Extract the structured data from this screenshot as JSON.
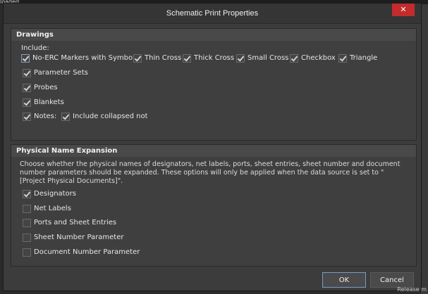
{
  "background": {
    "top_left_text": "loaded",
    "right_bottom_text": "Release m"
  },
  "dialog": {
    "title": "Schematic Print Properties",
    "close_label": "✕"
  },
  "drawings": {
    "header": "Drawings",
    "include_label": "Include:",
    "no_erc": {
      "label": "No-ERC Markers with Symbols:",
      "checked": true
    },
    "symbols": [
      {
        "label": "Thin Cross",
        "checked": true
      },
      {
        "label": "Thick Cross",
        "checked": true
      },
      {
        "label": "Small Cross",
        "checked": true
      },
      {
        "label": "Checkbox",
        "checked": true
      },
      {
        "label": "Triangle",
        "checked": true
      }
    ],
    "parameter_sets": {
      "label": "Parameter Sets",
      "checked": true
    },
    "probes": {
      "label": "Probes",
      "checked": true
    },
    "blankets": {
      "label": "Blankets",
      "checked": true
    },
    "notes": {
      "label": "Notes:",
      "checked": true
    },
    "include_collapsed": {
      "label": "Include collapsed notes",
      "checked": true
    }
  },
  "physical": {
    "header": "Physical Name Expansion",
    "description": "Choose whether the physical names of designators, net labels, ports, sheet entries, sheet number and document number parameters should be expanded. These options will only be applied when the data source is set to \"[Project Physical Documents]\".",
    "options": [
      {
        "label": "Designators",
        "checked": true
      },
      {
        "label": "Net Labels",
        "checked": false
      },
      {
        "label": "Ports and Sheet Entries",
        "checked": false
      },
      {
        "label": "Sheet Number Parameter",
        "checked": false
      },
      {
        "label": "Document Number Parameter",
        "checked": false
      }
    ]
  },
  "buttons": {
    "ok": "OK",
    "cancel": "Cancel"
  }
}
